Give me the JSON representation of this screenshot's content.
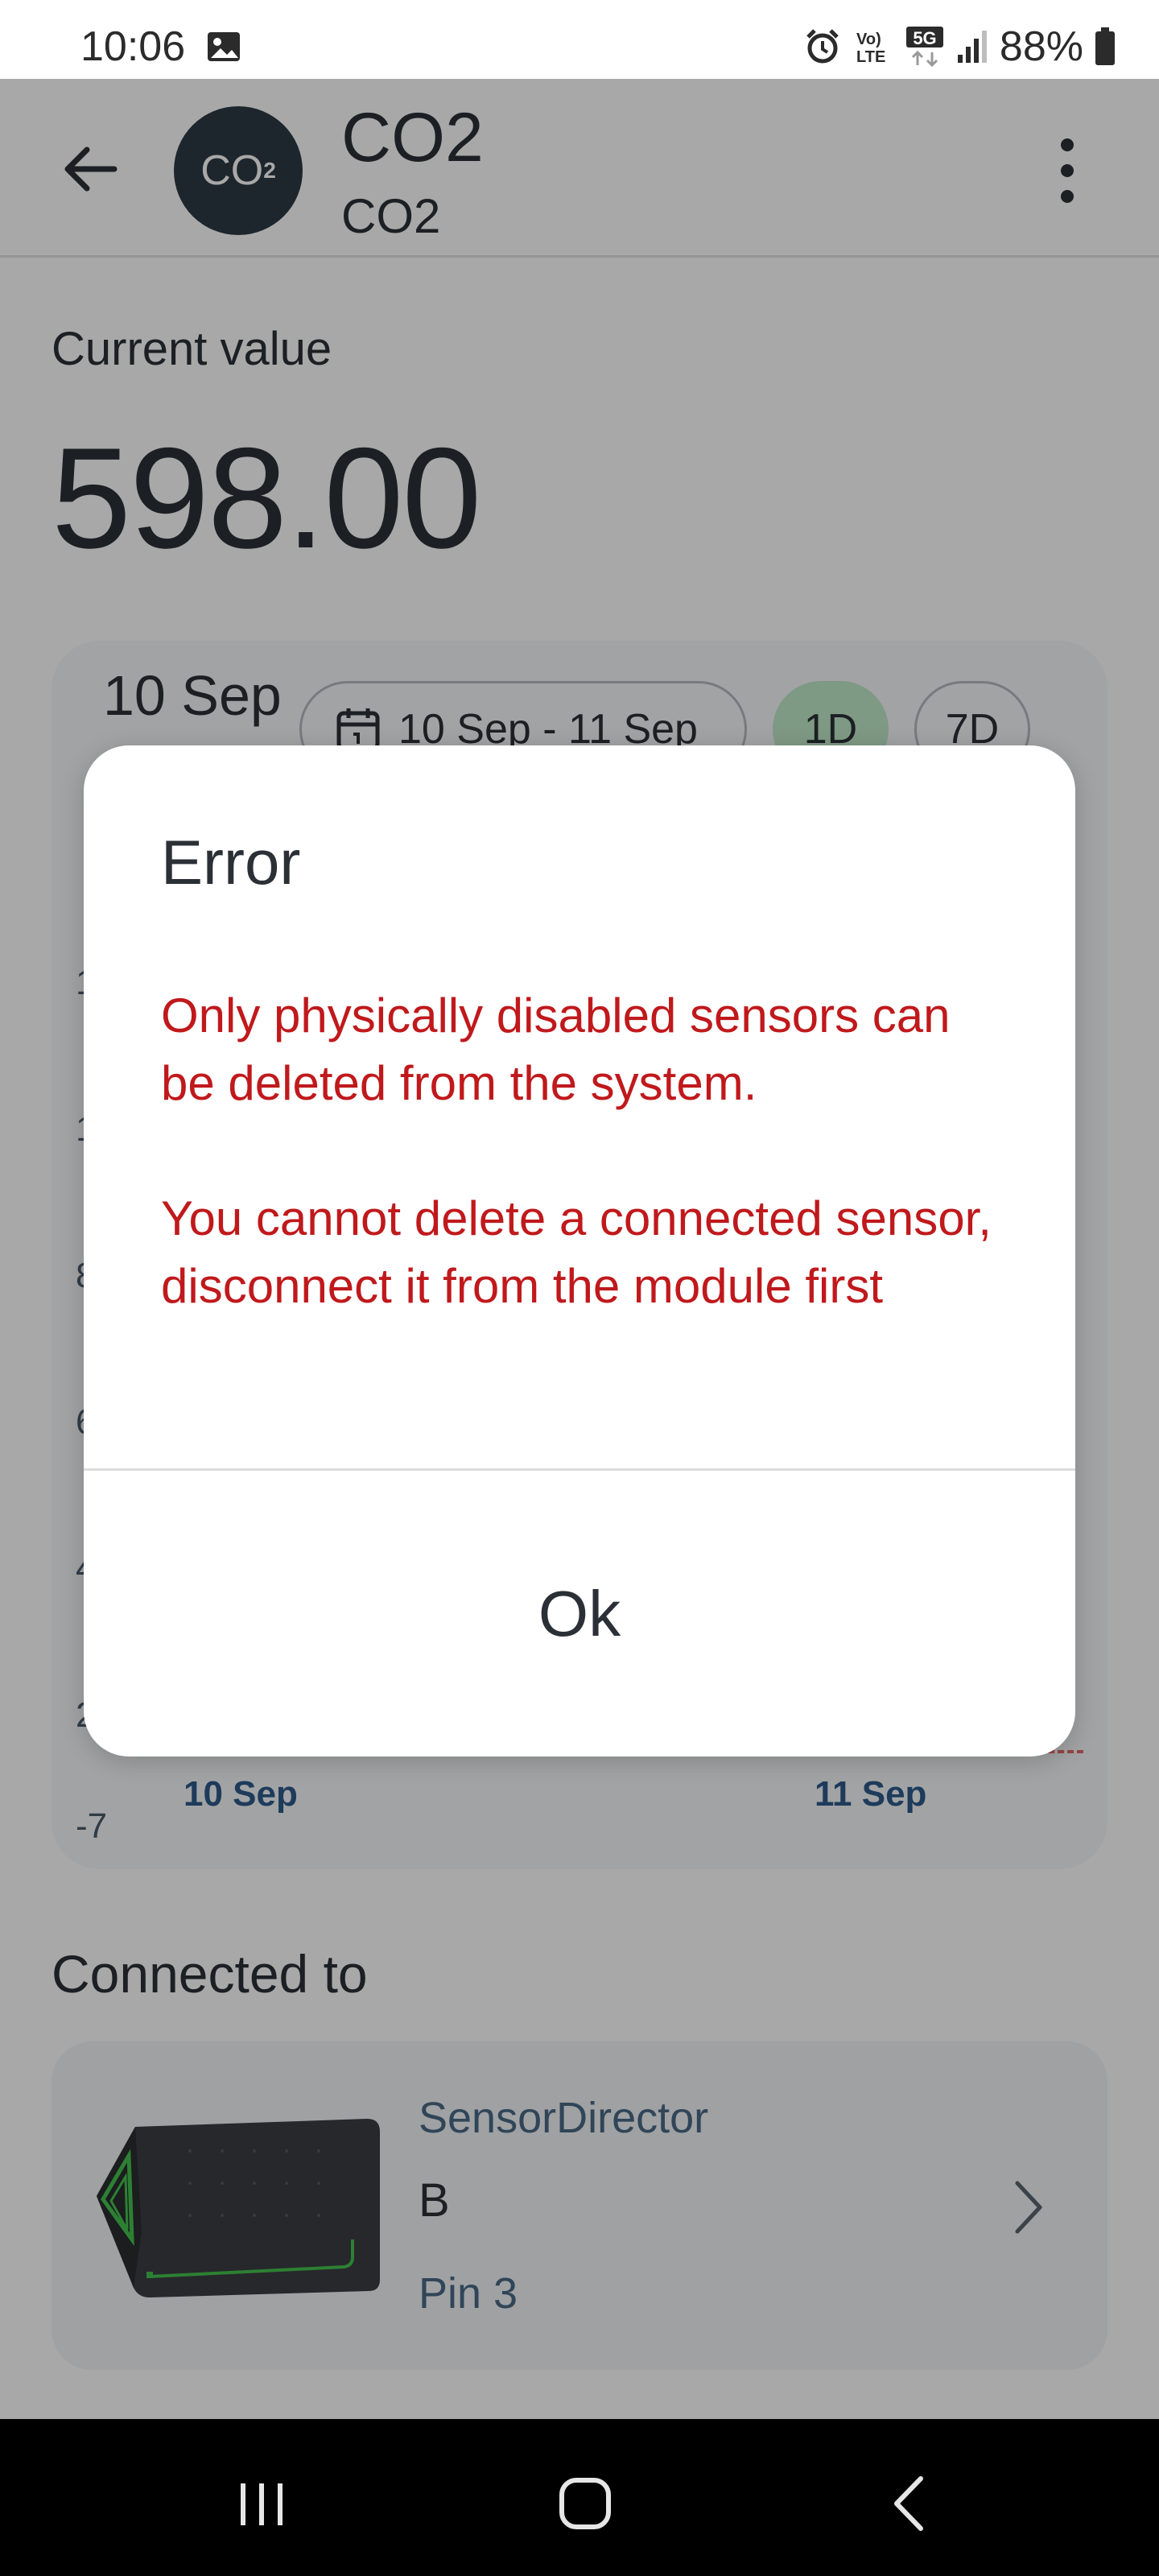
{
  "status_bar": {
    "time": "10:06",
    "network": "5G",
    "battery": "88%"
  },
  "header": {
    "avatar_text": "CO",
    "avatar_sub": "2",
    "title": "CO2",
    "subtitle": "CO2"
  },
  "current": {
    "label": "Current value",
    "value": "598.00"
  },
  "chart": {
    "date": "10 Sep",
    "range_label": "10 Sep - 11 Sep",
    "period_1d": "1D",
    "period_7d": "7D",
    "y_ticks_partial": [
      "1",
      "1",
      "8",
      "6",
      "4",
      "2",
      "-7"
    ],
    "x_labels": [
      "10 Sep",
      "11 Sep"
    ]
  },
  "connected": {
    "title": "Connected to",
    "device_brand": "SensorDirector",
    "device_name": "B",
    "device_pin": "Pin 3"
  },
  "dialog": {
    "title": "Error",
    "message_1": "Only physically disabled sensors can be deleted from the system.",
    "message_2": "You cannot delete a connected sensor, disconnect it from the module first",
    "ok_label": "Ok"
  },
  "colors": {
    "error_text": "#c0191c",
    "selected_period": "#bfe9c8",
    "avatar_bg": "#2c3a44",
    "threshold_line": "#e46a6a"
  }
}
